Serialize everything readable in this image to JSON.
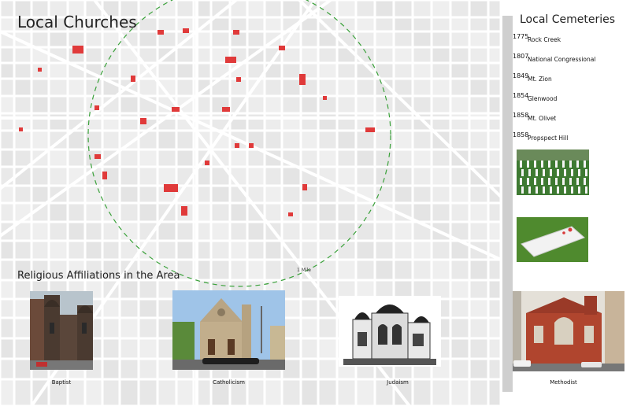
{
  "map": {
    "title": "Local Churches",
    "radius_label": "1 Mile",
    "church_color": "#e03a3a",
    "circle_color": "#3aa13a"
  },
  "affiliations": {
    "title": "Religious Affiliations in the Area",
    "items": [
      {
        "label": "Baptist",
        "image": "baptist-church-photo"
      },
      {
        "label": "Catholicism",
        "image": "catholic-church-photo"
      },
      {
        "label": "Judaism",
        "image": "synagogue-photo"
      },
      {
        "label": "Methodist",
        "image": "methodist-church-photo"
      }
    ]
  },
  "cemeteries": {
    "title": "Local Cemeteries",
    "items": [
      {
        "year": "1775",
        "name": "Rock Creek"
      },
      {
        "year": "1807",
        "name": "National Congressional"
      },
      {
        "year": "1849",
        "name": "Mt. Zion"
      },
      {
        "year": "1854",
        "name": "Glenwood"
      },
      {
        "year": "1858",
        "name": "Mt. Olivet"
      },
      {
        "year": "1858",
        "name": "Propspect Hill"
      }
    ],
    "photos": [
      "cemetery-graves-photo",
      "grave-slab-photo"
    ]
  }
}
